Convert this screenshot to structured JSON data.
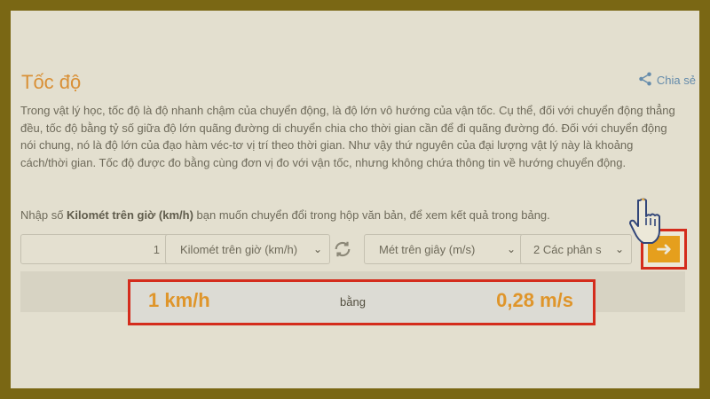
{
  "page": {
    "title": "Tốc độ",
    "share_label": "Chia sẻ"
  },
  "content": {
    "paragraph": "Trong vật lý học, tốc độ là độ nhanh chậm của chuyển động, là độ lớn vô hướng của vận tốc. Cụ thể, đối với chuyển động thẳng đều, tốc độ bằng tỷ số giữa độ lớn quãng đường di chuyển chia cho thời gian cần để đi quãng đường đó. Đối với chuyển động nói chung, nó là độ lớn của đạo hàm véc-tơ vị trí theo thời gian. Như vậy thứ nguyên của đại lượng vật lý này là khoảng cách/thời gian. Tốc độ được đo bằng cùng đơn vị đo với vận tốc, nhưng không chứa thông tin về hướng chuyển động.",
    "instruction_prefix": "Nhập số ",
    "instruction_bold": "Kilomét trên giờ (km/h)",
    "instruction_suffix": " bạn muốn chuyển đổi trong hộp văn bản, để xem kết quả trong bảng."
  },
  "converter": {
    "input_value": "1",
    "from_unit": "Kilomét trên giờ (km/h)",
    "to_unit": "Mét trên giây (m/s)",
    "precision": "2 Các phân s"
  },
  "result": {
    "from": "1 km/h",
    "equals": "bằng",
    "to": "0,28 m/s"
  },
  "colors": {
    "accent": "#ef9a2b",
    "highlight": "#e21a1a",
    "button": "#f7a71c",
    "link": "#5a8ec8"
  },
  "icons": {
    "share": "share-icon",
    "swap": "swap-icon",
    "go": "arrow-right-icon",
    "cursor": "hand-pointer-icon"
  }
}
